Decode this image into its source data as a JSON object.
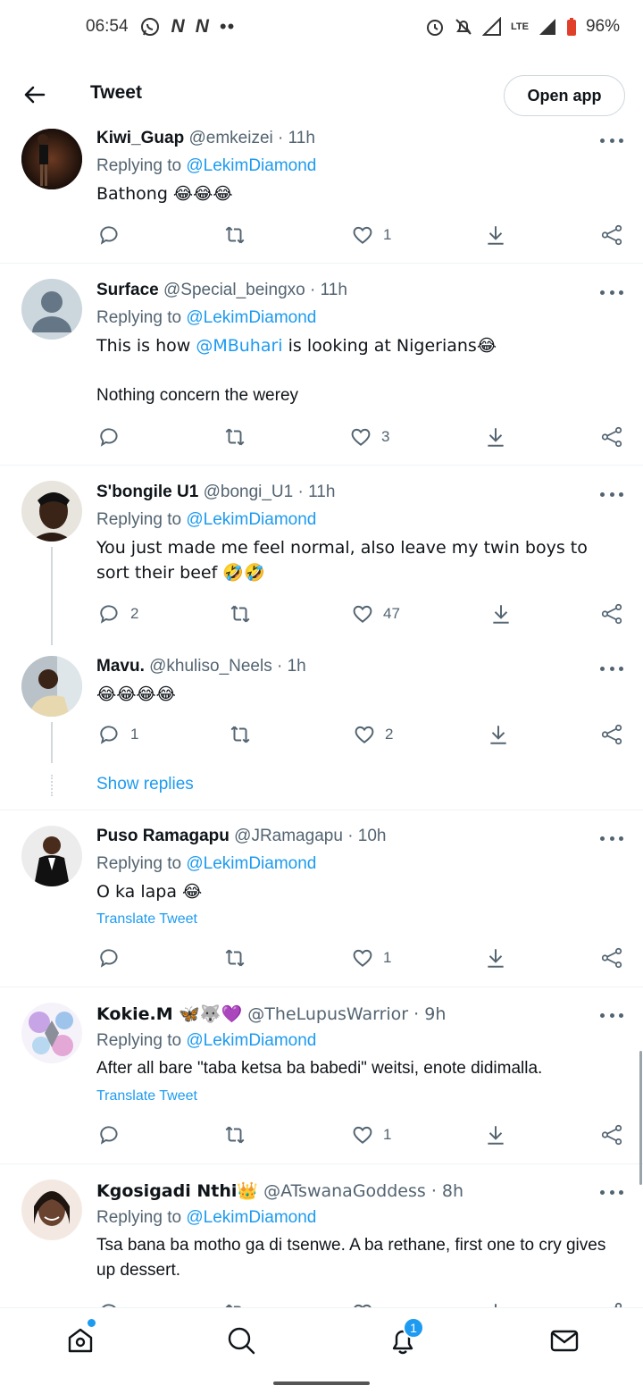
{
  "status_bar": {
    "time": "06:54",
    "battery": "96%",
    "network": "LTE"
  },
  "header": {
    "title": "Tweet",
    "open_app": "Open app"
  },
  "tweets": [
    {
      "name": "Kiwi_Guap",
      "handle": "@emkeizei",
      "time": "· 11h",
      "replying_prefix": "Replying to",
      "replying_to": "@LekimDiamond",
      "text": "Bathong 😂😂😂",
      "replies": "",
      "likes": "1"
    },
    {
      "name": "Surface",
      "handle": "@Special_beingxo",
      "time": "· 11h",
      "replying_prefix": "Replying to",
      "replying_to": "@LekimDiamond",
      "text_before": "This is how ",
      "mention": "@MBuhari",
      "text_after": " is looking at Nigerians😂",
      "text2": "Nothing concern the werey",
      "replies": "",
      "likes": "3"
    },
    {
      "name": "S'bongile U1",
      "handle": "@bongi_U1",
      "time": "· 11h",
      "replying_prefix": "Replying to",
      "replying_to": "@LekimDiamond",
      "text": "You just made me feel normal, also leave my twin boys to sort their beef 🤣🤣",
      "replies": "2",
      "likes": "47"
    },
    {
      "name": "Mavu.",
      "handle": "@khuliso_Neels",
      "time": "· 1h",
      "text": "😂😂😂😂",
      "replies": "1",
      "likes": "2"
    },
    {
      "name": "Puso Ramagapu",
      "handle": "@JRamagapu",
      "time": "· 10h",
      "replying_prefix": "Replying to",
      "replying_to": "@LekimDiamond",
      "text": "O ka lapa 😂",
      "translate": "Translate Tweet",
      "replies": "",
      "likes": "1"
    },
    {
      "name": "Kokie.M 🦋🐺💜",
      "handle": "@TheLupusWarrior",
      "time": "· 9h",
      "replying_prefix": "Replying to",
      "replying_to": "@LekimDiamond",
      "text": "After all bare \"taba ketsa ba babedi\" weitsi, enote didimalla.",
      "translate": "Translate Tweet",
      "replies": "",
      "likes": "1"
    },
    {
      "name": "Kgosigadi Nthi👑",
      "handle": "@ATswanaGoddess",
      "time": "· 8h",
      "replying_prefix": "Replying to",
      "replying_to": "@LekimDiamond",
      "text": "Tsa bana ba motho ga di tsenwe. A ba rethane, first one to cry gives up dessert."
    }
  ],
  "show_replies": "Show replies",
  "bottom_nav": {
    "notifications_count": "1"
  },
  "icons": [
    "back-arrow-icon",
    "reply-icon",
    "retweet-icon",
    "heart-icon",
    "download-icon",
    "share-icon",
    "home-icon",
    "search-icon",
    "bell-icon",
    "mail-icon"
  ],
  "colors": {
    "link": "#1d9bf0",
    "secondary_text": "#536471",
    "primary_text": "#0f1419"
  }
}
